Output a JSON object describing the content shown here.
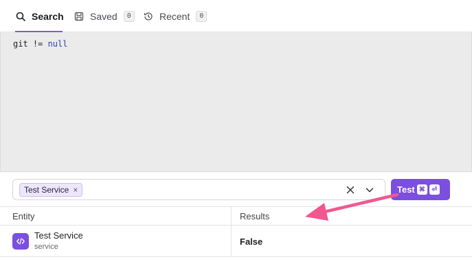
{
  "tabs": [
    {
      "label": "Search",
      "icon": "search-icon",
      "active": true
    },
    {
      "label": "Saved",
      "icon": "save-icon",
      "count": "0"
    },
    {
      "label": "Recent",
      "icon": "history-icon",
      "count": "0"
    }
  ],
  "editor": {
    "code_prefix": "git != ",
    "code_keyword": "null"
  },
  "entity_picker": {
    "selected_chip": "Test Service",
    "chip_remove": "×"
  },
  "test_button": {
    "label": "Test",
    "shortcut_keys": [
      "⌘",
      "⏎"
    ]
  },
  "table": {
    "headers": [
      "Entity",
      "Results"
    ],
    "rows": [
      {
        "entity_name": "Test Service",
        "entity_type": "service",
        "result": "False"
      }
    ]
  },
  "colors": {
    "accent": "#7b4fe0",
    "annotation_arrow": "#f0588f"
  }
}
